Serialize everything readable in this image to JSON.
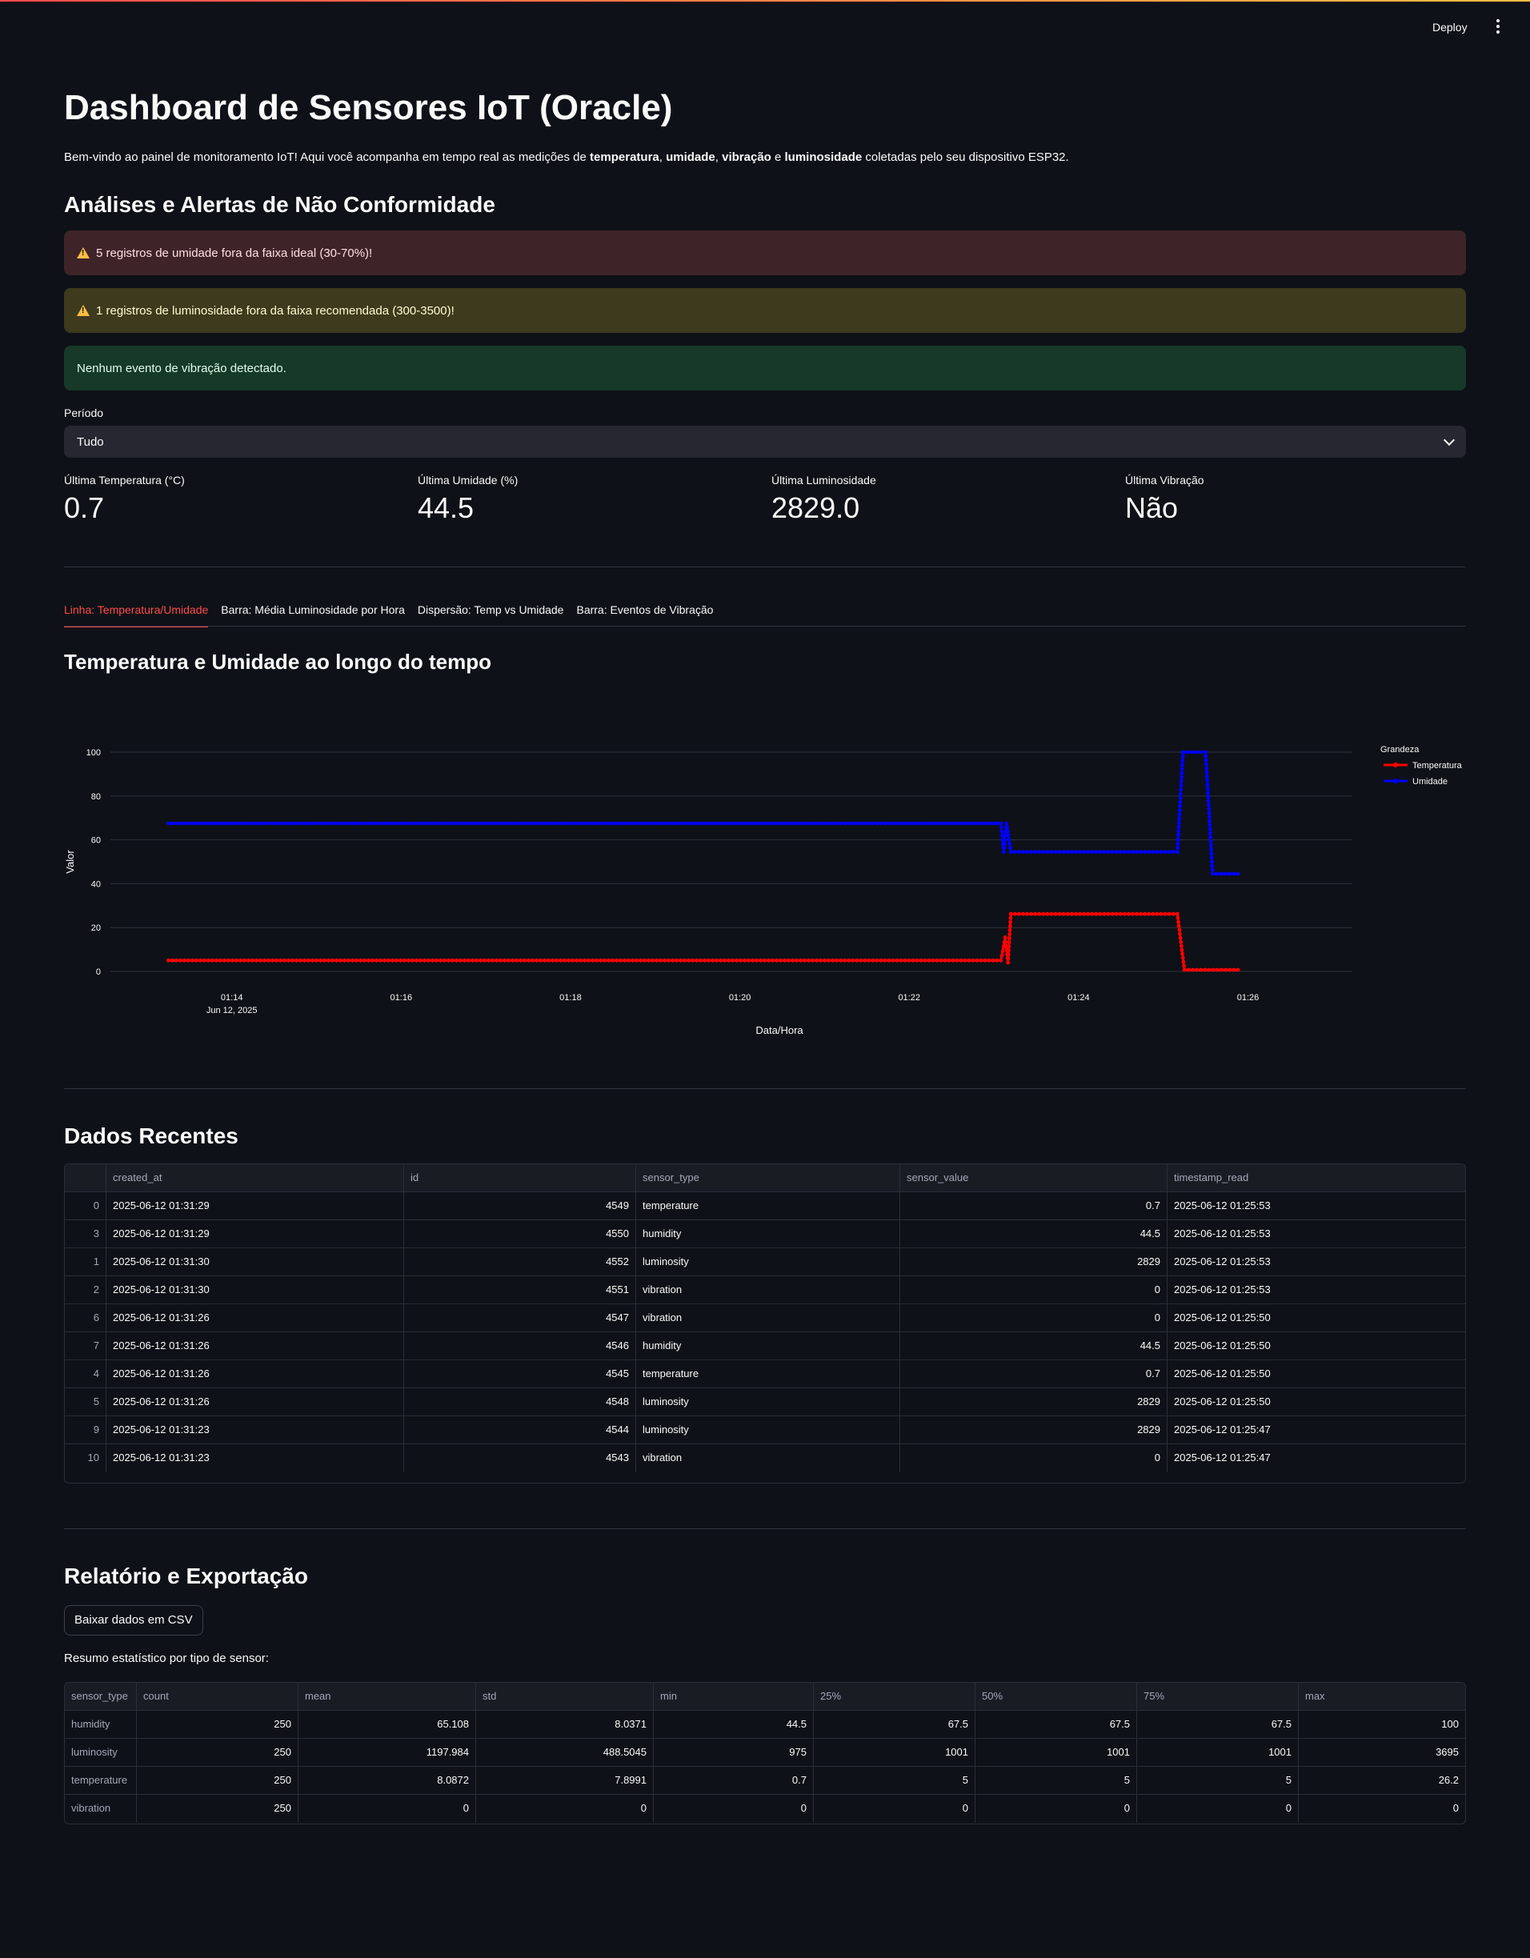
{
  "header": {
    "deploy_label": "Deploy",
    "menu_icon": "kebab-menu-icon"
  },
  "page": {
    "title": "Dashboard de Sensores IoT (Oracle)",
    "intro": {
      "part1": "Bem-vindo ao painel de monitoramento IoT! Aqui você acompanha em tempo real as medições de ",
      "b1": "temperatura",
      "sep1": ", ",
      "b2": "umidade",
      "sep2": ", ",
      "b3": "vibração",
      "sep3": " e ",
      "b4": "luminosidade",
      "part2": " coletadas pelo seu dispositivo ESP32."
    }
  },
  "alerts_section": {
    "title": "Análises e Alertas de Não Conformidade",
    "alerts": [
      {
        "text": "5 registros de umidade fora da faixa ideal (30-70%)!",
        "color": "#3e2429",
        "icon": "warning-icon"
      },
      {
        "text": "1 registros de luminosidade fora da faixa recomendada (300-3500)!",
        "color": "#3d3a1e",
        "icon": "warning-icon"
      },
      {
        "text": "Nenhum evento de vibração detectado.",
        "color": "#173928"
      }
    ]
  },
  "filter": {
    "label": "Período",
    "selected": "Tudo"
  },
  "metrics": [
    {
      "label": "Última Temperatura (°C)",
      "value": "0.7"
    },
    {
      "label": "Última Umidade (%)",
      "value": "44.5"
    },
    {
      "label": "Última Luminosidade",
      "value": "2829.0"
    },
    {
      "label": "Última Vibração",
      "value": "Não"
    }
  ],
  "tabs": [
    {
      "label": "Linha: Temperatura/Umidade",
      "active": true
    },
    {
      "label": "Barra: Média Luminosidade por Hora",
      "active": false
    },
    {
      "label": "Dispersão: Temp vs Umidade",
      "active": false
    },
    {
      "label": "Barra: Eventos de Vibração",
      "active": false
    }
  ],
  "chart_section": {
    "title": "Temperatura e Umidade ao longo do tempo"
  },
  "chart_data": {
    "type": "line",
    "xlabel": "Data/Hora",
    "ylabel": "Valor",
    "ylim": [
      0,
      100
    ],
    "yticks": [
      0,
      20,
      40,
      60,
      80,
      100
    ],
    "xticks": [
      "01:14",
      "01:16",
      "01:18",
      "01:20",
      "01:22",
      "01:24",
      "01:26"
    ],
    "x_date_label": "Jun 12, 2025",
    "legend_title": "Grandeza",
    "legend_position": "top-right",
    "grid": true,
    "series": [
      {
        "name": "Temperatura",
        "color": "#ff0000",
        "points": [
          [
            "01:13:15",
            5
          ],
          [
            "01:23:05",
            5
          ],
          [
            "01:23:08",
            15.5
          ],
          [
            "01:23:10",
            4
          ],
          [
            "01:23:12",
            26.2
          ],
          [
            "01:25:10",
            26.2
          ],
          [
            "01:25:15",
            0.7
          ],
          [
            "01:25:53",
            0.7
          ]
        ]
      },
      {
        "name": "Umidade",
        "color": "#0000ff",
        "points": [
          [
            "01:13:15",
            67.5
          ],
          [
            "01:23:05",
            67.5
          ],
          [
            "01:23:07",
            54.5
          ],
          [
            "01:23:09",
            67.5
          ],
          [
            "01:23:12",
            54.5
          ],
          [
            "01:25:10",
            54.5
          ],
          [
            "01:25:14",
            100
          ],
          [
            "01:25:30",
            100
          ],
          [
            "01:25:35",
            44.5
          ],
          [
            "01:25:53",
            44.5
          ]
        ]
      }
    ]
  },
  "recent_section": {
    "title": "Dados Recentes",
    "columns": [
      "",
      "created_at",
      "id",
      "sensor_type",
      "sensor_value",
      "timestamp_read"
    ],
    "rows": [
      [
        "0",
        "2025-06-12 01:31:29",
        "4549",
        "temperature",
        "0.7",
        "2025-06-12 01:25:53"
      ],
      [
        "3",
        "2025-06-12 01:31:29",
        "4550",
        "humidity",
        "44.5",
        "2025-06-12 01:25:53"
      ],
      [
        "1",
        "2025-06-12 01:31:30",
        "4552",
        "luminosity",
        "2829",
        "2025-06-12 01:25:53"
      ],
      [
        "2",
        "2025-06-12 01:31:30",
        "4551",
        "vibration",
        "0",
        "2025-06-12 01:25:53"
      ],
      [
        "6",
        "2025-06-12 01:31:26",
        "4547",
        "vibration",
        "0",
        "2025-06-12 01:25:50"
      ],
      [
        "7",
        "2025-06-12 01:31:26",
        "4546",
        "humidity",
        "44.5",
        "2025-06-12 01:25:50"
      ],
      [
        "4",
        "2025-06-12 01:31:26",
        "4545",
        "temperature",
        "0.7",
        "2025-06-12 01:25:50"
      ],
      [
        "5",
        "2025-06-12 01:31:26",
        "4548",
        "luminosity",
        "2829",
        "2025-06-12 01:25:50"
      ],
      [
        "9",
        "2025-06-12 01:31:23",
        "4544",
        "luminosity",
        "2829",
        "2025-06-12 01:25:47"
      ],
      [
        "10",
        "2025-06-12 01:31:23",
        "4543",
        "vibration",
        "0",
        "2025-06-12 01:25:47"
      ]
    ]
  },
  "report_section": {
    "title": "Relatório e Exportação",
    "download_label": "Baixar dados em CSV",
    "summary_label": "Resumo estatístico por tipo de sensor:",
    "columns": [
      "sensor_type",
      "count",
      "mean",
      "std",
      "min",
      "25%",
      "50%",
      "75%",
      "max"
    ],
    "rows": [
      [
        "humidity",
        "250",
        "65.108",
        "8.0371",
        "44.5",
        "67.5",
        "67.5",
        "67.5",
        "100"
      ],
      [
        "luminosity",
        "250",
        "1197.984",
        "488.5045",
        "975",
        "1001",
        "1001",
        "1001",
        "3695"
      ],
      [
        "temperature",
        "250",
        "8.0872",
        "7.8991",
        "0.7",
        "5",
        "5",
        "5",
        "26.2"
      ],
      [
        "vibration",
        "250",
        "0",
        "0",
        "0",
        "0",
        "0",
        "0",
        "0"
      ]
    ]
  }
}
